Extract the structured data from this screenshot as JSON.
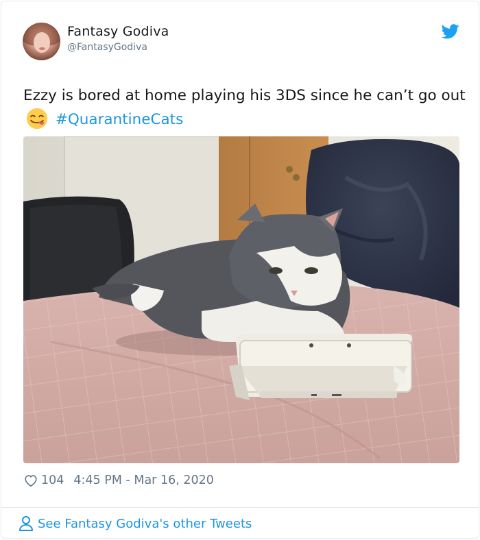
{
  "tweet": {
    "author": {
      "display_name": "Fantasy Godiva",
      "handle": "@FantasyGodiva",
      "avatar": "avatar-photo"
    },
    "text": "Ezzy is bored at home playing his 3DS since he can’t go out",
    "emoji": "face-savoring-food-emoji",
    "hashtag": "#QuarantineCats",
    "media": {
      "description_icon": "photo",
      "subject": "cat-with-3ds"
    },
    "likes": "104",
    "timestamp": "4:45 PM - Mar 16, 2020",
    "footer_link": "See Fantasy Godiva's other Tweets"
  },
  "colors": {
    "link_blue": "#1b95e0",
    "text_primary": "#14171a",
    "text_secondary": "#657786",
    "border": "#e1e8ed"
  },
  "icons": {
    "brand": "twitter-bird-icon",
    "like": "heart-outline-icon",
    "profile": "person-outline-icon"
  }
}
